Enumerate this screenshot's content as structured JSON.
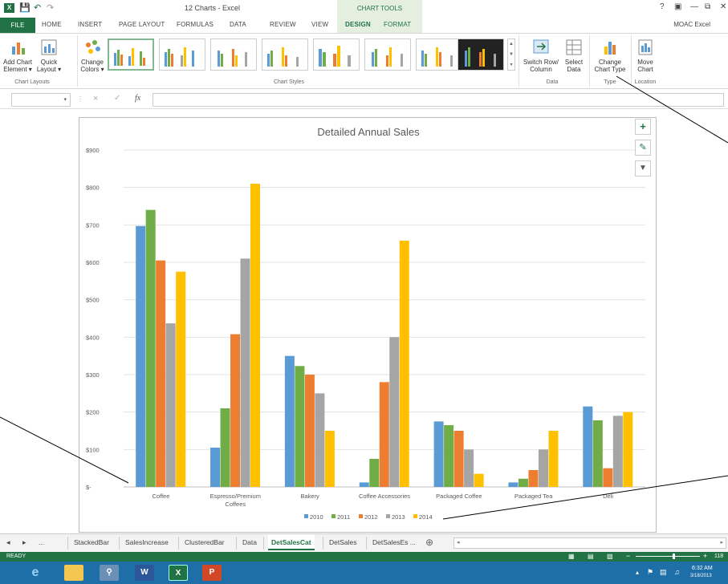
{
  "window": {
    "title": "12 Charts - Excel",
    "context_label": "CHART TOOLS",
    "help": "?",
    "user": "MOAC Excel"
  },
  "tabs": {
    "file": "FILE",
    "items": [
      "HOME",
      "INSERT",
      "PAGE LAYOUT",
      "FORMULAS",
      "DATA",
      "REVIEW",
      "VIEW",
      "DESIGN",
      "FORMAT"
    ]
  },
  "ribbon": {
    "add_chart_element": "Add Chart Element",
    "add_chart_element_l1": "Add Chart",
    "add_chart_element_l2": "Element ▾",
    "quick_layout_l1": "Quick",
    "quick_layout_l2": "Layout ▾",
    "change_colors_l1": "Change",
    "change_colors_l2": "Colors ▾",
    "group_chart_layouts": "Chart Layouts",
    "group_chart_styles": "Chart Styles",
    "switch_row_l1": "Switch Row/",
    "switch_row_l2": "Column",
    "select_data_l1": "Select",
    "select_data_l2": "Data",
    "group_data": "Data",
    "change_type_l1": "Change",
    "change_type_l2": "Chart Type",
    "group_type": "Type",
    "move_chart_l1": "Move",
    "move_chart_l2": "Chart",
    "group_location": "Location"
  },
  "formula_bar": {
    "fx": "fx",
    "cancel": "×",
    "enter": "✓",
    "value": ""
  },
  "chart_data": {
    "type": "bar",
    "title": "Detailed Annual Sales",
    "categories": [
      "Coffee",
      "Espresso/Premium Coffees",
      "Bakery",
      "Coffee Accessories",
      "Packaged Coffee",
      "Packaged Tea",
      "Deli"
    ],
    "category_labels_l1": [
      "Coffee",
      "Espresso/Premium",
      "Bakery",
      "Coffee Accessories",
      "Packaged Coffee",
      "Packaged Tea",
      "Deli"
    ],
    "category_labels_l2": [
      "",
      "Coffees",
      "",
      "",
      "",
      "",
      ""
    ],
    "series": [
      {
        "name": "2010",
        "color": "#5b9bd5",
        "values": [
          697,
          105,
          350,
          12,
          175,
          12,
          215
        ]
      },
      {
        "name": "2011",
        "color": "#70ad47",
        "values": [
          740,
          210,
          323,
          75,
          165,
          22,
          178
        ]
      },
      {
        "name": "2012",
        "color": "#ed7d31",
        "values": [
          605,
          408,
          300,
          280,
          150,
          45,
          50
        ]
      },
      {
        "name": "2013",
        "color": "#a5a5a5",
        "values": [
          437,
          610,
          250,
          400,
          100,
          100,
          190
        ]
      },
      {
        "name": "2014",
        "color": "#ffc000",
        "values": [
          575,
          810,
          150,
          658,
          35,
          150,
          200
        ]
      }
    ],
    "ylim": [
      0,
      900
    ],
    "yticks": [
      0,
      100,
      200,
      300,
      400,
      500,
      600,
      700,
      800,
      900
    ],
    "ytick_labels": [
      "$-",
      "$100",
      "$200",
      "$300",
      "$400",
      "$500",
      "$600",
      "$700",
      "$800",
      "$900"
    ],
    "grid": true,
    "legend_position": "bottom"
  },
  "chart_buttons": {
    "elements": "+",
    "styles": "✎",
    "filter": "▼"
  },
  "sheet_tabs": {
    "nav_prev": "◂",
    "nav_next": "▸",
    "ellipsis": "...",
    "tabs": [
      "StackedBar",
      "SalesIncrease",
      "ClusteredBar",
      "Data",
      "DetSalesCat",
      "DetSales",
      "DetSalesEs ..."
    ],
    "active": "DetSalesCat",
    "add": "⊕"
  },
  "status": {
    "ready": "READY",
    "zoom": "118"
  },
  "taskbar": {
    "time": "6:32 AM",
    "date": "3/18/2013"
  }
}
